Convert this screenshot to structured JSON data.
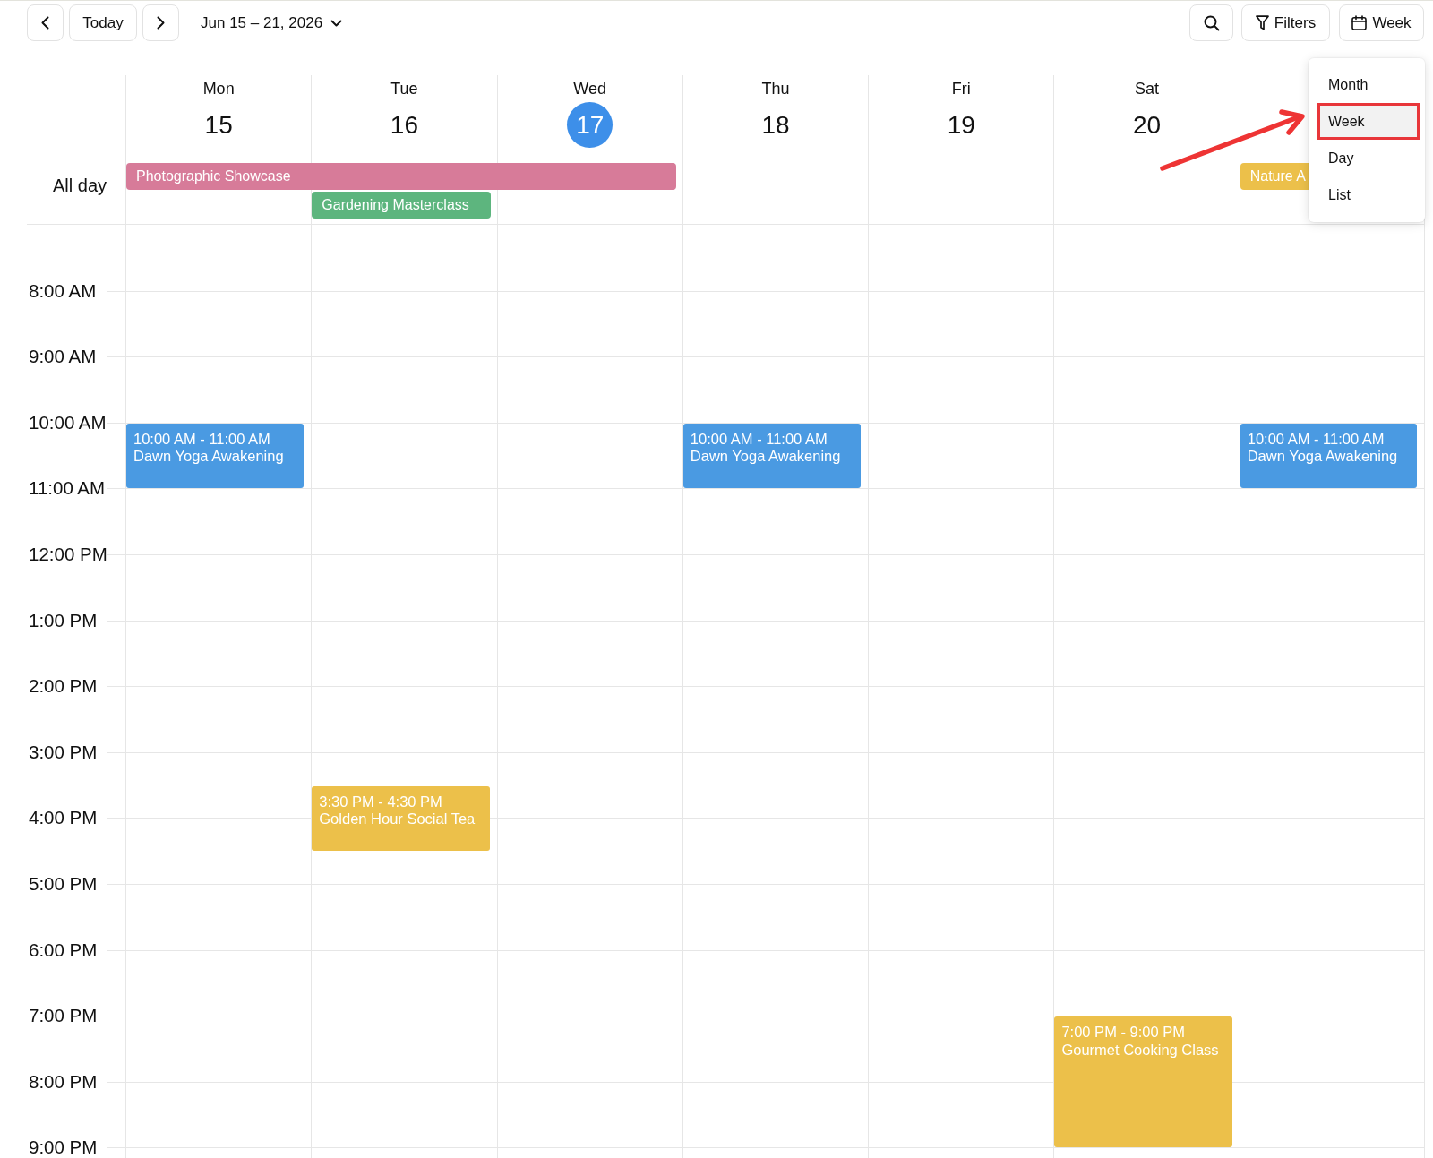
{
  "toolbar": {
    "today_button": "Today",
    "date_range": "Jun 15 – 21, 2026",
    "filters_button": "Filters",
    "view_button": "Week"
  },
  "view_menu": {
    "items": [
      {
        "label": "Month",
        "selected": false,
        "annotated": false
      },
      {
        "label": "Week",
        "selected": true,
        "annotated": true
      },
      {
        "label": "Day",
        "selected": false,
        "annotated": false
      },
      {
        "label": "List",
        "selected": false,
        "annotated": false
      }
    ]
  },
  "all_day": {
    "label": "All day"
  },
  "days": [
    {
      "name": "Mon",
      "date": "15",
      "today": false,
      "all_day": [
        {
          "kind": "event",
          "title": "Photographic Showcase",
          "color": "#d77b99"
        }
      ],
      "events": [
        {
          "time": "10:00 AM - 11:00 AM",
          "title": "Dawn Yoga Awakening",
          "color": "#4a9ae2"
        }
      ]
    },
    {
      "name": "Tue",
      "date": "16",
      "today": false,
      "all_day": [
        {
          "kind": "continued"
        },
        {
          "kind": "event",
          "title": "Gardening Masterclass",
          "color": "#5db57e"
        }
      ],
      "events": [
        {
          "time": "3:30 PM - 4:30 PM",
          "title": "Golden Hour Social Tea",
          "color": "#ecc04a"
        }
      ]
    },
    {
      "name": "Wed",
      "date": "17",
      "today": true,
      "all_day": [
        {
          "kind": "continued"
        }
      ]
    },
    {
      "name": "Thu",
      "date": "18",
      "today": false,
      "events": [
        {
          "time": "10:00 AM - 11:00 AM",
          "title": "Dawn Yoga Awakening",
          "color": "#4a9ae2"
        }
      ]
    },
    {
      "name": "Fri",
      "date": "19",
      "today": false
    },
    {
      "name": "Sat",
      "date": "20",
      "today": false,
      "events": [
        {
          "time": "7:00 PM - 9:00 PM",
          "title": "Gourmet Cooking Class",
          "color": "#ecc04a"
        }
      ]
    },
    {
      "all_day": [
        {
          "kind": "event",
          "title": "Nature A",
          "color": "#ecc04a"
        }
      ],
      "events": [
        {
          "time": "10:00 AM - 11:00 AM",
          "title": "Dawn Yoga Awakening",
          "color": "#4a9ae2"
        }
      ]
    }
  ],
  "time_grid": {
    "hour_labels": [
      "8:00 AM",
      "9:00 AM",
      "10:00 AM",
      "11:00 AM",
      "12:00 PM",
      "1:00 PM",
      "2:00 PM",
      "3:00 PM",
      "4:00 PM",
      "5:00 PM",
      "6:00 PM",
      "7:00 PM",
      "8:00 PM",
      "9:00 PM"
    ]
  }
}
